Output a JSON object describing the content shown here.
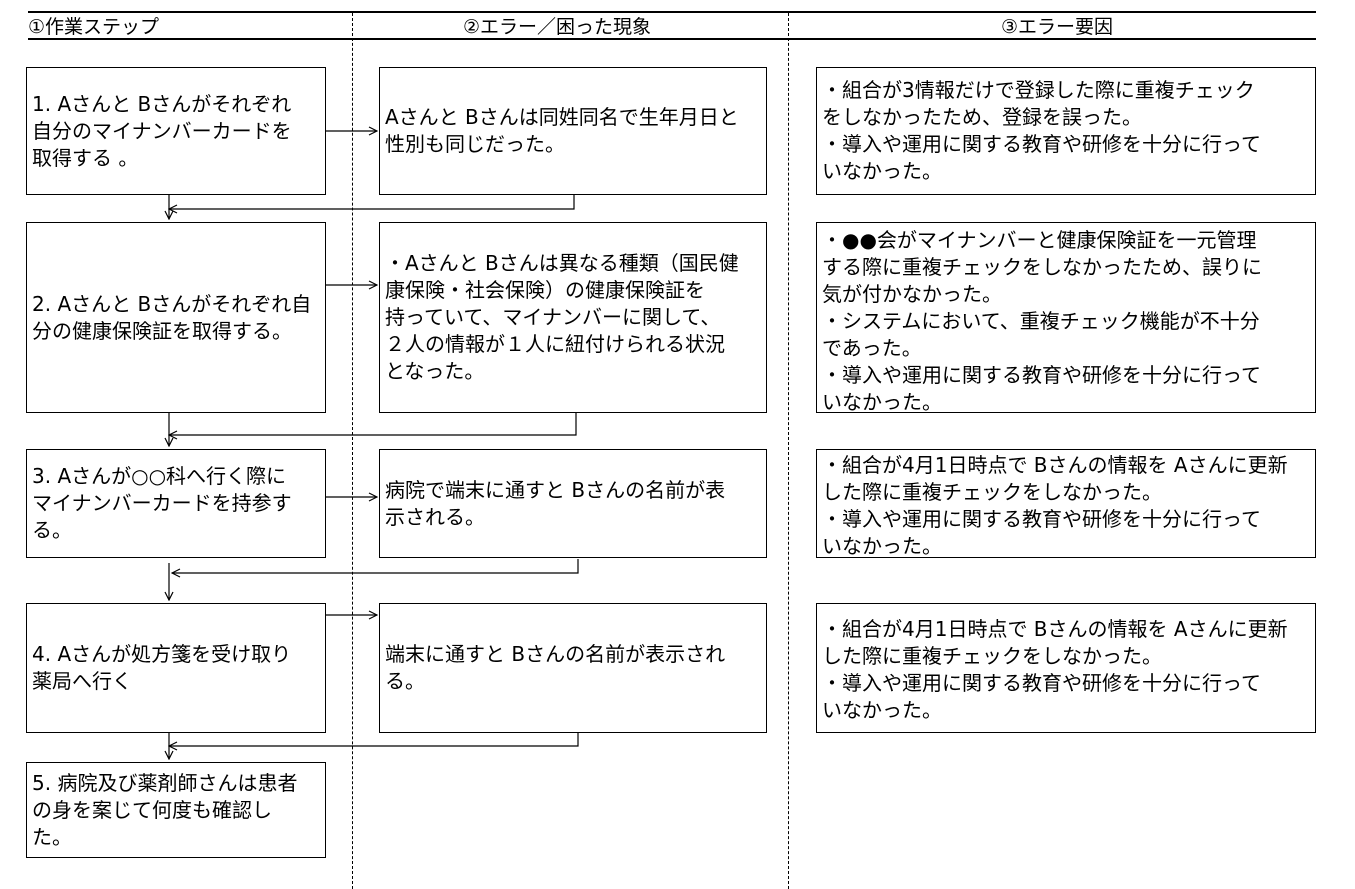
{
  "headers": {
    "col1": "①作業ステップ",
    "col2": "②エラー／困った現象",
    "col3": "③エラー要因"
  },
  "steps": [
    "1. Aさんと Bさんがそれぞれ\n自分のマイナンバーカードを\n取得する 。",
    "2. Aさんと Bさんがそれぞれ自\n分の健康保険証を取得する。",
    "3. Aさんが○○科へ行く際に\nマイナンバーカードを持参す\nる。",
    "4. Aさんが処方箋を受け取り\n薬局へ行く",
    "5. 病院及び薬剤師さんは患者\nの身を案じて何度も確認し\nた。"
  ],
  "errors": [
    "Aさんと Bさんは同姓同名で生年月日と\n性別も同じだった。",
    "・Aさんと Bさんは異なる種類（国民健\n康保険・社会保険）の健康保険証を\n持っていて、マイナンバーに関して、\n２人の情報が１人に紐付けられる状況\nとなった。",
    "病院で端末に通すと Bさんの名前が表\n示される。",
    "端末に通すと Bさんの名前が表示され\nる。"
  ],
  "causes": [
    "・組合が3情報だけで登録した際に重複チェック\nをしなかったため、登録を誤った。\n・導入や運用に関する教育や研修を十分に行って\nいなかった。",
    "・●●会がマイナンバーと健康保険証を一元管理\nする際に重複チェックをしなかったため、誤りに\n気が付かなかった。\n・システムにおいて、重複チェック機能が不十分\nであった。\n・導入や運用に関する教育や研修を十分に行って\nいなかった。",
    "・組合が4月1日時点で Bさんの情報を Aさんに更新\nした際に重複チェックをしなかった。\n・導入や運用に関する教育や研修を十分に行って\nいなかった。",
    "・組合が4月1日時点で Bさんの情報を Aさんに更新\nした際に重複チェックをしなかった。\n・導入や運用に関する教育や研修を十分に行って\nいなかった。"
  ]
}
